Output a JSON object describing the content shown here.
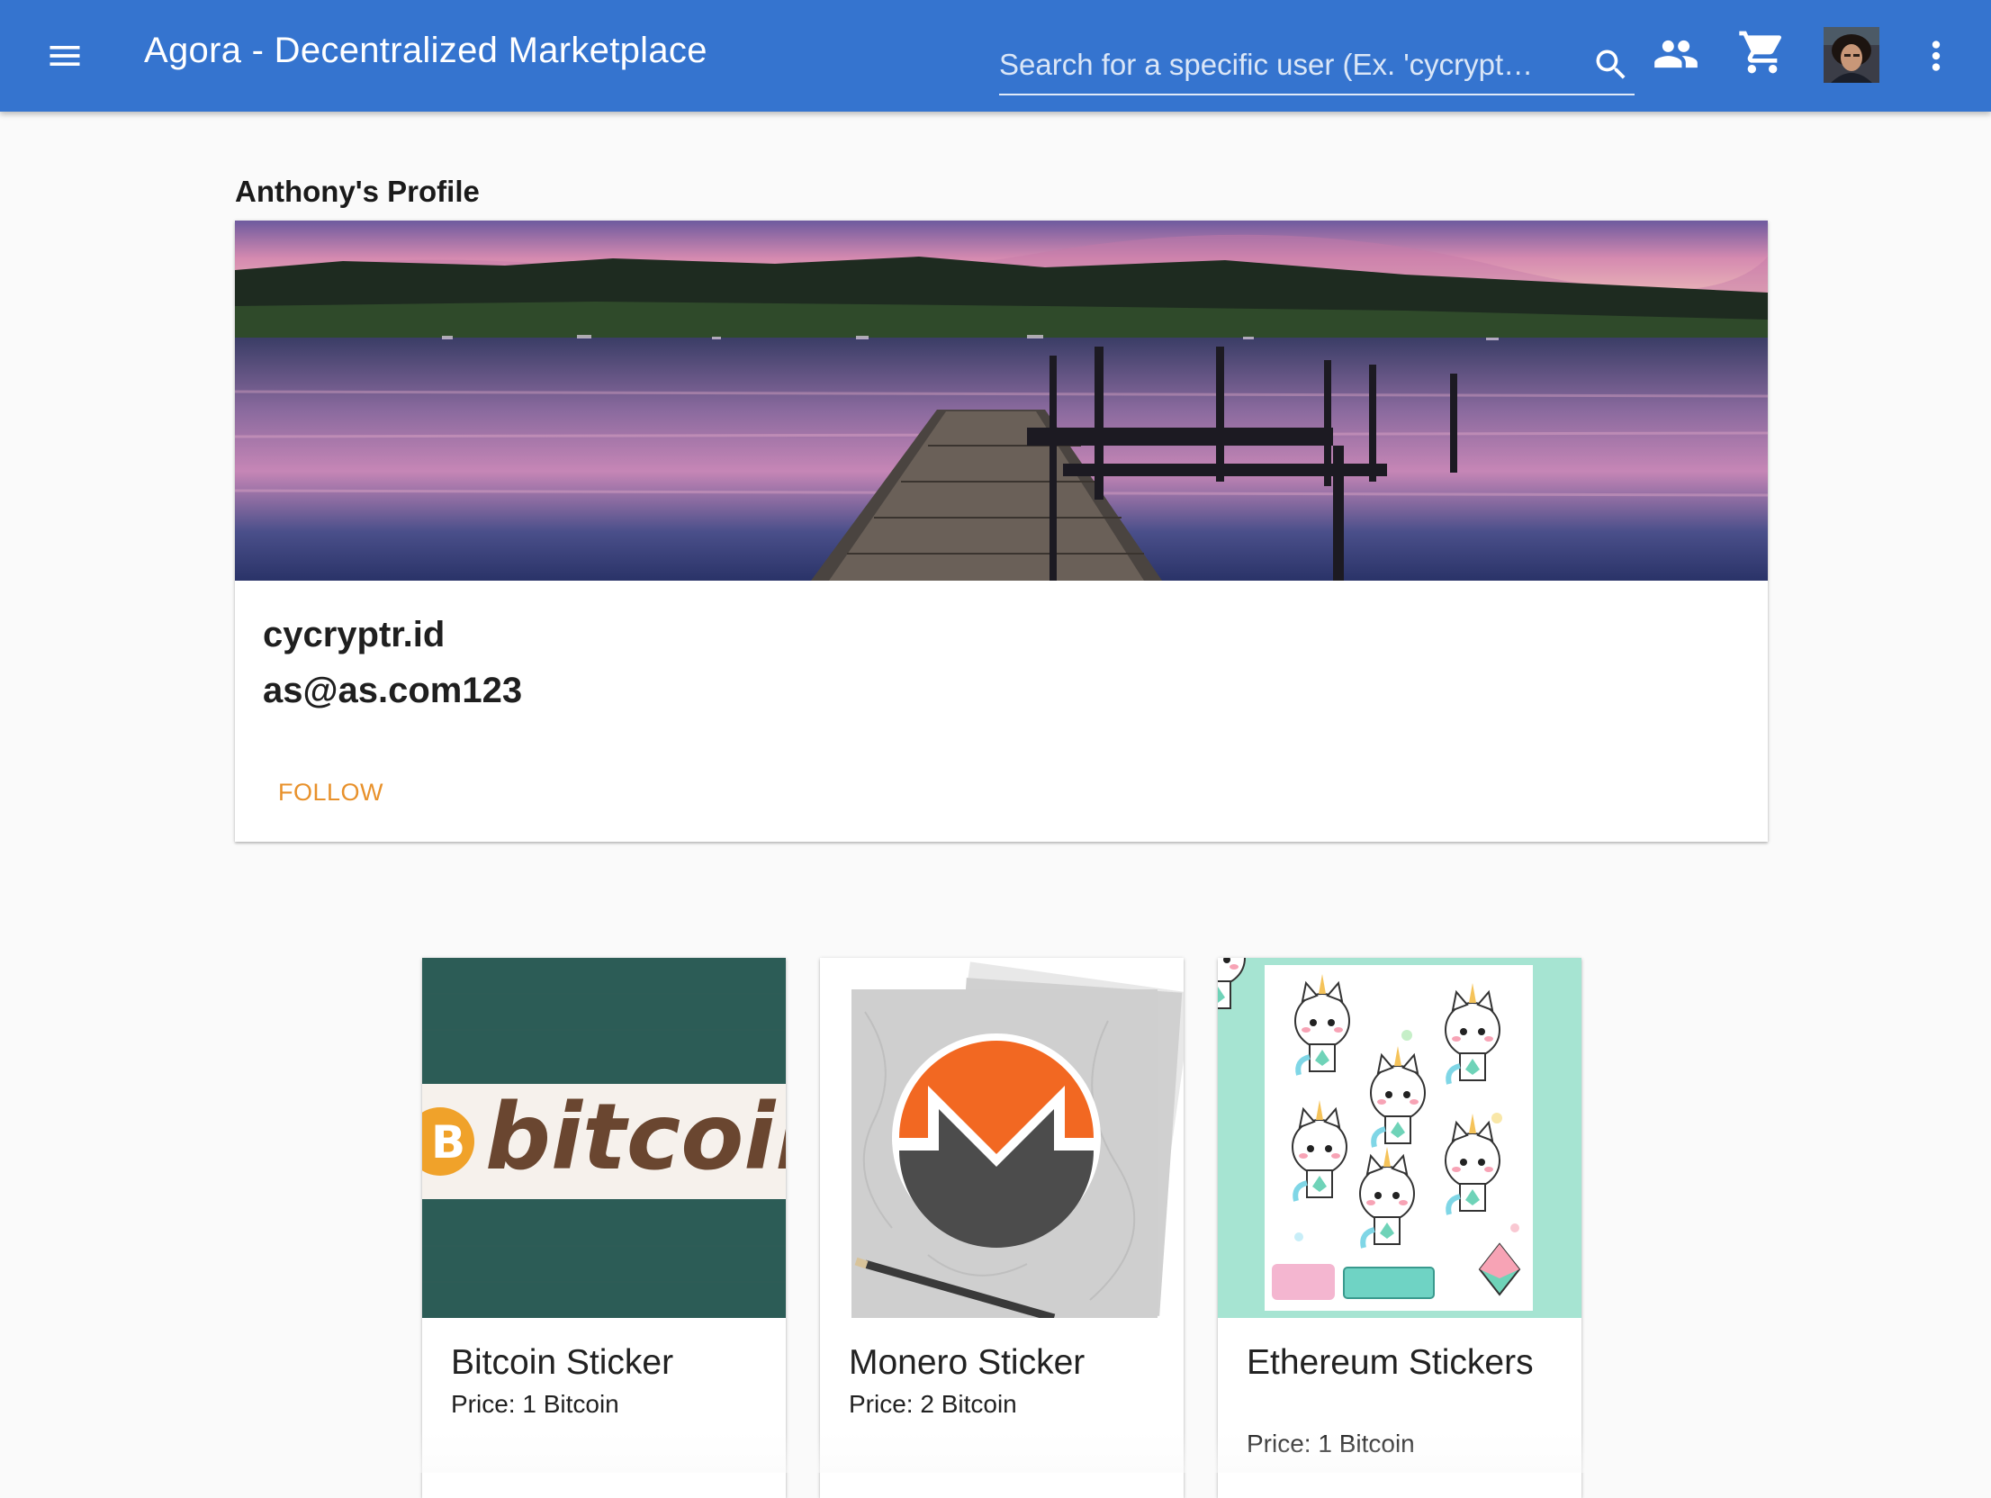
{
  "header": {
    "title": "Agora - Decentralized Marketplace",
    "search_placeholder": "Search for a specific user (Ex. 'cycrypt…",
    "icons": [
      "menu-icon",
      "search-icon",
      "people-icon",
      "shopping-cart-icon",
      "avatar",
      "more-vert-icon"
    ],
    "brand_color": "#3574cf"
  },
  "profile": {
    "heading": "Anthony's Profile",
    "username": "cycryptr.id",
    "email": "as@as.com123",
    "follow_label": "FOLLOW",
    "follow_color": "#e8912b"
  },
  "products": [
    {
      "name": "Bitcoin Sticker",
      "price": "Price: 1 Bitcoin"
    },
    {
      "name": "Monero Sticker",
      "price": "Price: 2 Bitcoin"
    },
    {
      "name": "Ethereum Stickers",
      "price": "Price: 1 Bitcoin"
    }
  ],
  "product_images": {
    "bitcoin": {
      "logo_text": "bitcoin"
    }
  }
}
